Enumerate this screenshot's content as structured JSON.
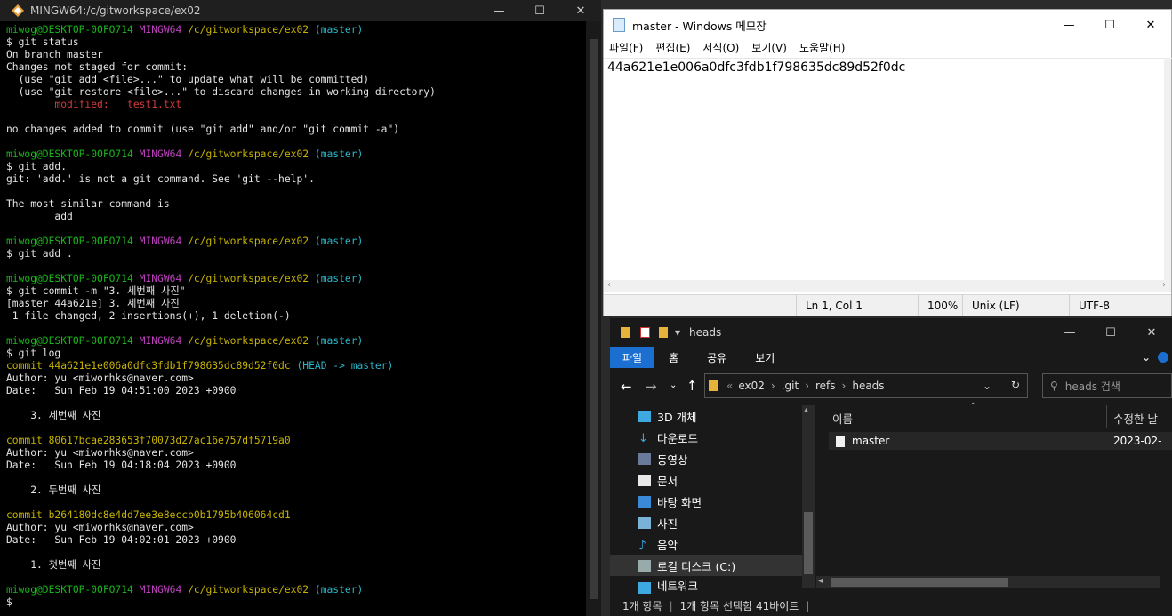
{
  "terminal": {
    "title": "MINGW64:/c/gitworkspace/ex02",
    "prompt": {
      "user": "miwog@DESKTOP-0OFO714",
      "env": "MINGW64",
      "path": "/c/gitworkspace/ex02",
      "branch": "(master)"
    },
    "lines": {
      "l1": "$ git status",
      "l2": "On branch master",
      "l3": "Changes not staged for commit:",
      "l4": "  (use \"git add <file>...\" to update what will be committed)",
      "l5": "  (use \"git restore <file>...\" to discard changes in working directory)",
      "l6": "        modified:   test1.txt",
      "l7": "no changes added to commit (use \"git add\" and/or \"git commit -a\")",
      "l8": "$ git add.",
      "l9": "git: 'add.' is not a git command. See 'git --help'.",
      "l10": "The most similar command is",
      "l11": "        add",
      "l12": "$ git add .",
      "l13": "$ git commit -m \"3. 세번째 사진\"",
      "l14": "[master 44a621e] 3. 세번째 사진",
      "l15": " 1 file changed, 2 insertions(+), 1 deletion(-)",
      "l16": "$ git log",
      "c1": "commit 44a621e1e006a0dfc3fdb1f798635dc89d52f0dc",
      "c1ref": "(HEAD -> master)",
      "c1author": "Author: yu <miworhks@naver.com>",
      "c1date": "Date:   Sun Feb 19 04:51:00 2023 +0900",
      "c1msg": "    3. 세번째 사진",
      "c2": "commit 80617bcae283653f70073d27ac16e757df5719a0",
      "c2author": "Author: yu <miworhks@naver.com>",
      "c2date": "Date:   Sun Feb 19 04:18:04 2023 +0900",
      "c2msg": "    2. 두번째 사진",
      "c3": "commit b264180dc8e4dd7ee3e8eccb0b1795b406064cd1",
      "c3author": "Author: yu <miworhks@naver.com>",
      "c3date": "Date:   Sun Feb 19 04:02:01 2023 +0900",
      "c3msg": "    1. 첫번째 사진",
      "last": "$"
    }
  },
  "notepad": {
    "title": "master - Windows 메모장",
    "menu": [
      "파일(F)",
      "편집(E)",
      "서식(O)",
      "보기(V)",
      "도움말(H)"
    ],
    "content": "44a621e1e006a0dfc3fdb1f798635dc89d52f0dc",
    "status": {
      "position": "Ln 1, Col 1",
      "zoom": "100%",
      "eol": "Unix (LF)",
      "encoding": "UTF-8"
    }
  },
  "explorer": {
    "title": "heads",
    "ribbon": [
      "파일",
      "홈",
      "공유",
      "보기"
    ],
    "breadcrumb": [
      "ex02",
      ".git",
      "refs",
      "heads"
    ],
    "search_placeholder": "heads 검색",
    "nav": [
      "3D 개체",
      "다운로드",
      "동영상",
      "문서",
      "바탕 화면",
      "사진",
      "음악",
      "로컬 디스크 (C:)",
      "네트워크"
    ],
    "columns": {
      "name": "이름",
      "modified": "수정한 날"
    },
    "files": [
      {
        "name": "master",
        "modified": "2023-02-"
      }
    ],
    "status": {
      "count": "1개 항목",
      "selected": "1개 항목 선택함 41바이트"
    }
  }
}
